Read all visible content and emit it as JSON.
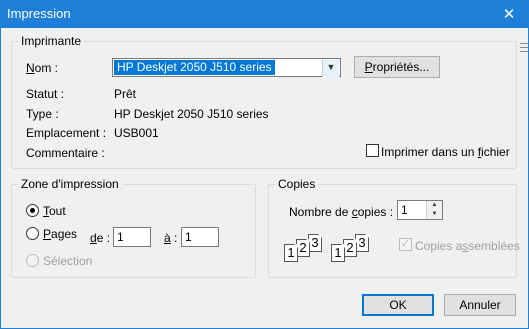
{
  "window": {
    "title": "Impression"
  },
  "printer": {
    "legend": "Imprimante",
    "name_label": "Nom :",
    "name_value": "HP Deskjet 2050 J510 series",
    "properties_button": "Propriétés...",
    "status_label": "Statut :",
    "status_value": "Prêt",
    "type_label": "Type :",
    "type_value": "HP Deskjet 2050 J510 series",
    "location_label": "Emplacement :",
    "location_value": "USB001",
    "comment_label": "Commentaire :",
    "print_to_file": {
      "label": "Imprimer dans un fichier",
      "checked": false
    }
  },
  "range": {
    "legend": "Zone d'impression",
    "all_label": "Tout",
    "pages_label": "Pages",
    "from_label": "de :",
    "from_value": "1",
    "to_label": "à :",
    "to_value": "1",
    "selection_label": "Sélection",
    "selected": "all"
  },
  "copies": {
    "legend": "Copies",
    "count_label": "Nombre de copies :",
    "count_value": "1",
    "collate_label": "Copies assemblées",
    "collate_checked": true,
    "collate_enabled": false,
    "page_numbers": [
      "1",
      "2",
      "3"
    ]
  },
  "buttons": {
    "ok": "OK",
    "cancel": "Annuler"
  }
}
